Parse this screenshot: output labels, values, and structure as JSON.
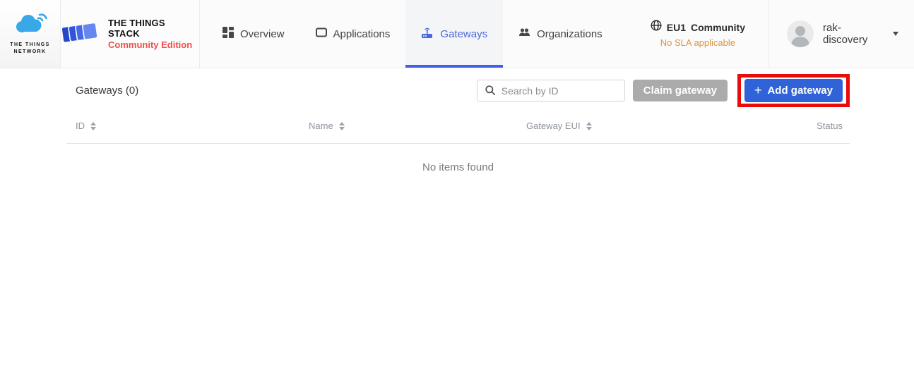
{
  "brand": {
    "network_name": "THE THINGS\nNETWORK",
    "stack_title": "THE THINGS STACK",
    "stack_subtitle": "Community Edition"
  },
  "nav": {
    "items": [
      {
        "label": "Overview",
        "active": false
      },
      {
        "label": "Applications",
        "active": false
      },
      {
        "label": "Gateways",
        "active": true
      },
      {
        "label": "Organizations",
        "active": false
      }
    ]
  },
  "cluster": {
    "id": "EU1",
    "name": "Community",
    "sla_note": "No SLA applicable"
  },
  "user": {
    "name": "rak-discovery"
  },
  "main": {
    "title": "Gateways (0)",
    "search_placeholder": "Search by ID",
    "claim_label": "Claim gateway",
    "add_label": "Add gateway",
    "add_plus": "+",
    "table": {
      "columns": [
        "ID",
        "Name",
        "Gateway EUI",
        "Status"
      ],
      "empty_message": "No items found"
    }
  },
  "colors": {
    "accent_blue": "#3063d8",
    "active_tab_blue": "#3e5fe8",
    "annotation_red": "#ea0b0b",
    "sla_orange": "#e0923f",
    "brand_red": "#f0504a",
    "cloud_blue": "#38a8e8",
    "claim_gray": "#ababab"
  }
}
